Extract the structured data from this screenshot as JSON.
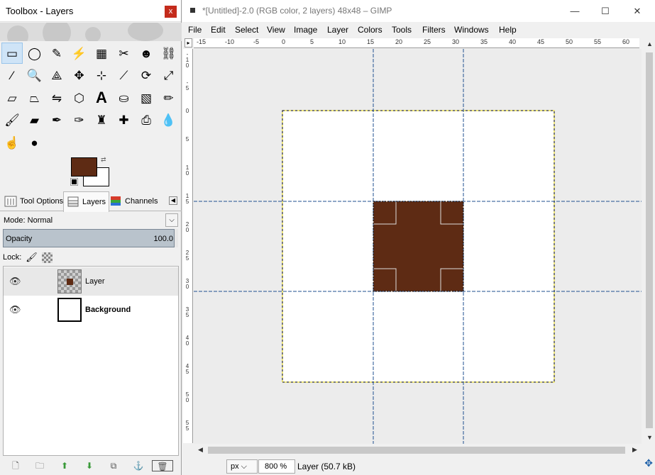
{
  "toolbox": {
    "title": "Toolbox - Layers",
    "close_label": "x",
    "tools": [
      {
        "name": "rect-select-icon",
        "glyph": "▭"
      },
      {
        "name": "ellipse-select-icon",
        "glyph": "◯"
      },
      {
        "name": "free-select-icon",
        "glyph": "✎"
      },
      {
        "name": "fuzzy-select-icon",
        "glyph": "⚡"
      },
      {
        "name": "select-by-color-icon",
        "glyph": "▦"
      },
      {
        "name": "scissors-select-icon",
        "glyph": "✂"
      },
      {
        "name": "foreground-select-icon",
        "glyph": "☻"
      },
      {
        "name": "paths-icon",
        "glyph": "⛓"
      },
      {
        "name": "color-picker-icon",
        "glyph": "⁄"
      },
      {
        "name": "zoom-icon",
        "glyph": "🔍"
      },
      {
        "name": "measure-icon",
        "glyph": "⟁"
      },
      {
        "name": "move-icon",
        "glyph": "✥"
      },
      {
        "name": "align-icon",
        "glyph": "⊹"
      },
      {
        "name": "crop-icon",
        "glyph": "⟋"
      },
      {
        "name": "rotate-icon",
        "glyph": "⟳"
      },
      {
        "name": "scale-icon",
        "glyph": "⤢"
      },
      {
        "name": "shear-icon",
        "glyph": "▱"
      },
      {
        "name": "perspective-icon",
        "glyph": "⏢"
      },
      {
        "name": "flip-icon",
        "glyph": "⇋"
      },
      {
        "name": "cage-icon",
        "glyph": "⬡"
      },
      {
        "name": "text-icon",
        "glyph": "A"
      },
      {
        "name": "bucket-fill-icon",
        "glyph": "⛀"
      },
      {
        "name": "blend-icon",
        "glyph": "▧"
      },
      {
        "name": "pencil-icon",
        "glyph": "✏"
      },
      {
        "name": "paintbrush-icon",
        "glyph": "🖌"
      },
      {
        "name": "eraser-icon",
        "glyph": "▰"
      },
      {
        "name": "airbrush-icon",
        "glyph": "✒"
      },
      {
        "name": "ink-icon",
        "glyph": "✑"
      },
      {
        "name": "clone-icon",
        "glyph": "♜"
      },
      {
        "name": "heal-icon",
        "glyph": "✚"
      },
      {
        "name": "perspective-clone-icon",
        "glyph": "⎙"
      },
      {
        "name": "blur-icon",
        "glyph": "💧"
      },
      {
        "name": "smudge-icon",
        "glyph": "☝"
      },
      {
        "name": "dodge-burn-icon",
        "glyph": "●"
      }
    ],
    "fg_color": "#5e2b14",
    "bg_color": "#ffffff",
    "tabs": {
      "tool_options": "Tool Options",
      "layers": "Layers",
      "channels": "Channels"
    },
    "mode_label": "Mode: Normal",
    "opacity_label": "Opacity",
    "opacity_value": "100.0",
    "lock_label": "Lock:",
    "layers": [
      {
        "name": "Layer",
        "bold": false,
        "selected": true,
        "type": "checker"
      },
      {
        "name": "Background",
        "bold": true,
        "selected": false,
        "type": "white"
      }
    ]
  },
  "image_window": {
    "title": "*[Untitled]-2.0 (RGB color, 2 layers) 48x48 – GIMP",
    "minimize": "—",
    "maximize": "☐",
    "close": "✕",
    "menu": [
      "File",
      "Edit",
      "Select",
      "View",
      "Image",
      "Layer",
      "Colors",
      "Tools",
      "Filters",
      "Windows",
      "Help"
    ],
    "ruler_h": [
      "-15",
      "-10",
      "-5",
      "0",
      "5",
      "10",
      "15",
      "20",
      "25",
      "30",
      "35",
      "40",
      "45",
      "50",
      "55",
      "60"
    ],
    "ruler_v": [
      "-10",
      "-5",
      "0",
      "5",
      "10",
      "15",
      "20",
      "25",
      "30",
      "35",
      "40",
      "45",
      "50",
      "55"
    ],
    "unit": "px",
    "zoom": "800 %",
    "status": "Layer (50.7 kB)",
    "canvas_fill": "#5e2b14"
  }
}
